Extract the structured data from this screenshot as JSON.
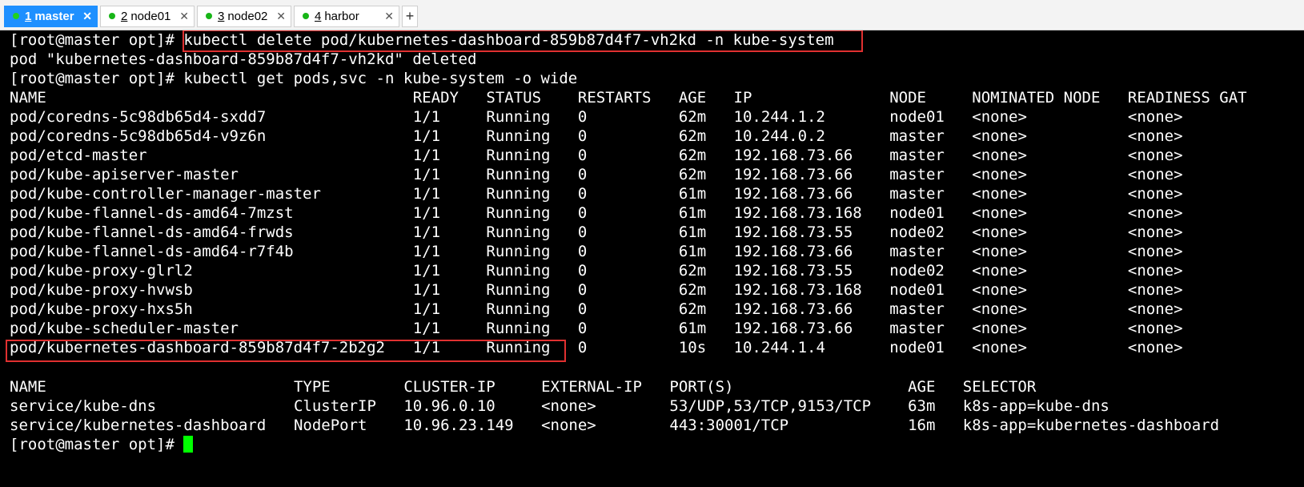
{
  "tabs": [
    {
      "num": "1",
      "name": "master",
      "close": "✕"
    },
    {
      "num": "2",
      "name": "node01",
      "close": "✕"
    },
    {
      "num": "3",
      "name": "node02",
      "close": "✕"
    },
    {
      "num": "4",
      "name": "harbor",
      "close": "✕"
    }
  ],
  "new_tab_label": "+",
  "status_dot_color": "#17b517",
  "active_tab_color": "#1e90ff",
  "highlight_color": "#e03030",
  "cursor_color": "#00ff00",
  "terminal": {
    "prompt": "[root@master opt]# ",
    "cmd1": "kubectl delete pod/kubernetes-dashboard-859b87d4f7-vh2kd -n kube-system",
    "out1": "pod \"kubernetes-dashboard-859b87d4f7-vh2kd\" deleted",
    "cmd2": "kubectl get pods,svc -n kube-system -o wide",
    "pod_headers": [
      "NAME",
      "READY",
      "STATUS",
      "RESTARTS",
      "AGE",
      "IP",
      "NODE",
      "NOMINATED NODE",
      "READINESS GAT"
    ],
    "pods": [
      [
        "pod/coredns-5c98db65d4-sxdd7",
        "1/1",
        "Running",
        "0",
        "62m",
        "10.244.1.2",
        "node01",
        "<none>",
        "<none>"
      ],
      [
        "pod/coredns-5c98db65d4-v9z6n",
        "1/1",
        "Running",
        "0",
        "62m",
        "10.244.0.2",
        "master",
        "<none>",
        "<none>"
      ],
      [
        "pod/etcd-master",
        "1/1",
        "Running",
        "0",
        "62m",
        "192.168.73.66",
        "master",
        "<none>",
        "<none>"
      ],
      [
        "pod/kube-apiserver-master",
        "1/1",
        "Running",
        "0",
        "62m",
        "192.168.73.66",
        "master",
        "<none>",
        "<none>"
      ],
      [
        "pod/kube-controller-manager-master",
        "1/1",
        "Running",
        "0",
        "61m",
        "192.168.73.66",
        "master",
        "<none>",
        "<none>"
      ],
      [
        "pod/kube-flannel-ds-amd64-7mzst",
        "1/1",
        "Running",
        "0",
        "61m",
        "192.168.73.168",
        "node01",
        "<none>",
        "<none>"
      ],
      [
        "pod/kube-flannel-ds-amd64-frwds",
        "1/1",
        "Running",
        "0",
        "61m",
        "192.168.73.55",
        "node02",
        "<none>",
        "<none>"
      ],
      [
        "pod/kube-flannel-ds-amd64-r7f4b",
        "1/1",
        "Running",
        "0",
        "61m",
        "192.168.73.66",
        "master",
        "<none>",
        "<none>"
      ],
      [
        "pod/kube-proxy-glrl2",
        "1/1",
        "Running",
        "0",
        "62m",
        "192.168.73.55",
        "node02",
        "<none>",
        "<none>"
      ],
      [
        "pod/kube-proxy-hvwsb",
        "1/1",
        "Running",
        "0",
        "62m",
        "192.168.73.168",
        "node01",
        "<none>",
        "<none>"
      ],
      [
        "pod/kube-proxy-hxs5h",
        "1/1",
        "Running",
        "0",
        "62m",
        "192.168.73.66",
        "master",
        "<none>",
        "<none>"
      ],
      [
        "pod/kube-scheduler-master",
        "1/1",
        "Running",
        "0",
        "61m",
        "192.168.73.66",
        "master",
        "<none>",
        "<none>"
      ],
      [
        "pod/kubernetes-dashboard-859b87d4f7-2b2g2",
        "1/1",
        "Running",
        "0",
        "10s",
        "10.244.1.4",
        "node01",
        "<none>",
        "<none>"
      ]
    ],
    "svc_headers": [
      "NAME",
      "TYPE",
      "CLUSTER-IP",
      "EXTERNAL-IP",
      "PORT(S)",
      "AGE",
      "SELECTOR"
    ],
    "services": [
      [
        "service/kube-dns",
        "ClusterIP",
        "10.96.0.10",
        "<none>",
        "53/UDP,53/TCP,9153/TCP",
        "63m",
        "k8s-app=kube-dns"
      ],
      [
        "service/kubernetes-dashboard",
        "NodePort",
        "10.96.23.149",
        "<none>",
        "443:30001/TCP",
        "16m",
        "k8s-app=kubernetes-dashboard"
      ]
    ]
  }
}
